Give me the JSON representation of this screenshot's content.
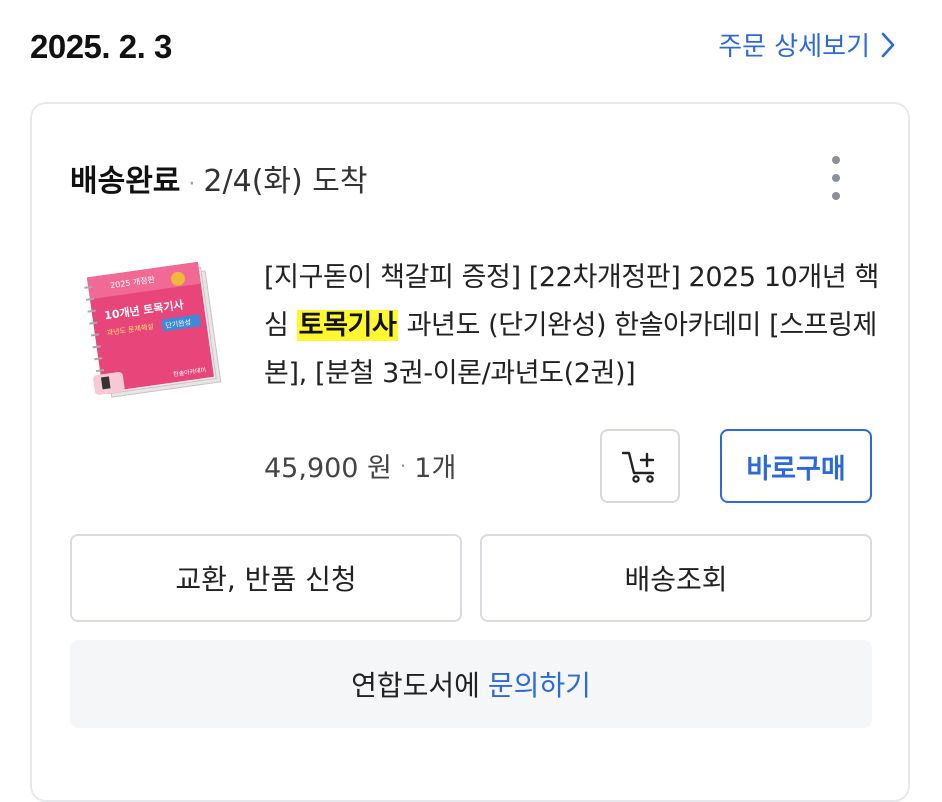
{
  "order": {
    "date": "2025. 2. 3",
    "detail_link": "주문 상세보기"
  },
  "shipment": {
    "status": "배송완료",
    "eta": "2/4(화) 도착"
  },
  "product": {
    "title_before": "[지구돋이 책갈피 증정] [22차개정판] 2025 10개년 핵심 ",
    "title_highlight": "토목기사",
    "title_after": " 과년도 (단기완성) 한솔아카데미 [스프링제본], [분철 3권-이론/과년도(2권)]",
    "price": "45,900 원",
    "quantity": "1개",
    "cover": {
      "top_text": "2025 개정판",
      "main_text": "10개년 토목기사",
      "sub_text": "과년도 문제해설",
      "tag_text": "단기완성",
      "publisher": "한솔아카데미"
    }
  },
  "buttons": {
    "buy_now": "바로구매",
    "return_exchange": "교환, 반품 신청",
    "track": "배송조회"
  },
  "inquiry": {
    "seller": "연합도서에",
    "link": "문의하기"
  },
  "colors": {
    "accent": "#2b6ad8",
    "highlight": "#fff730",
    "cover_pink": "#e8457a"
  }
}
